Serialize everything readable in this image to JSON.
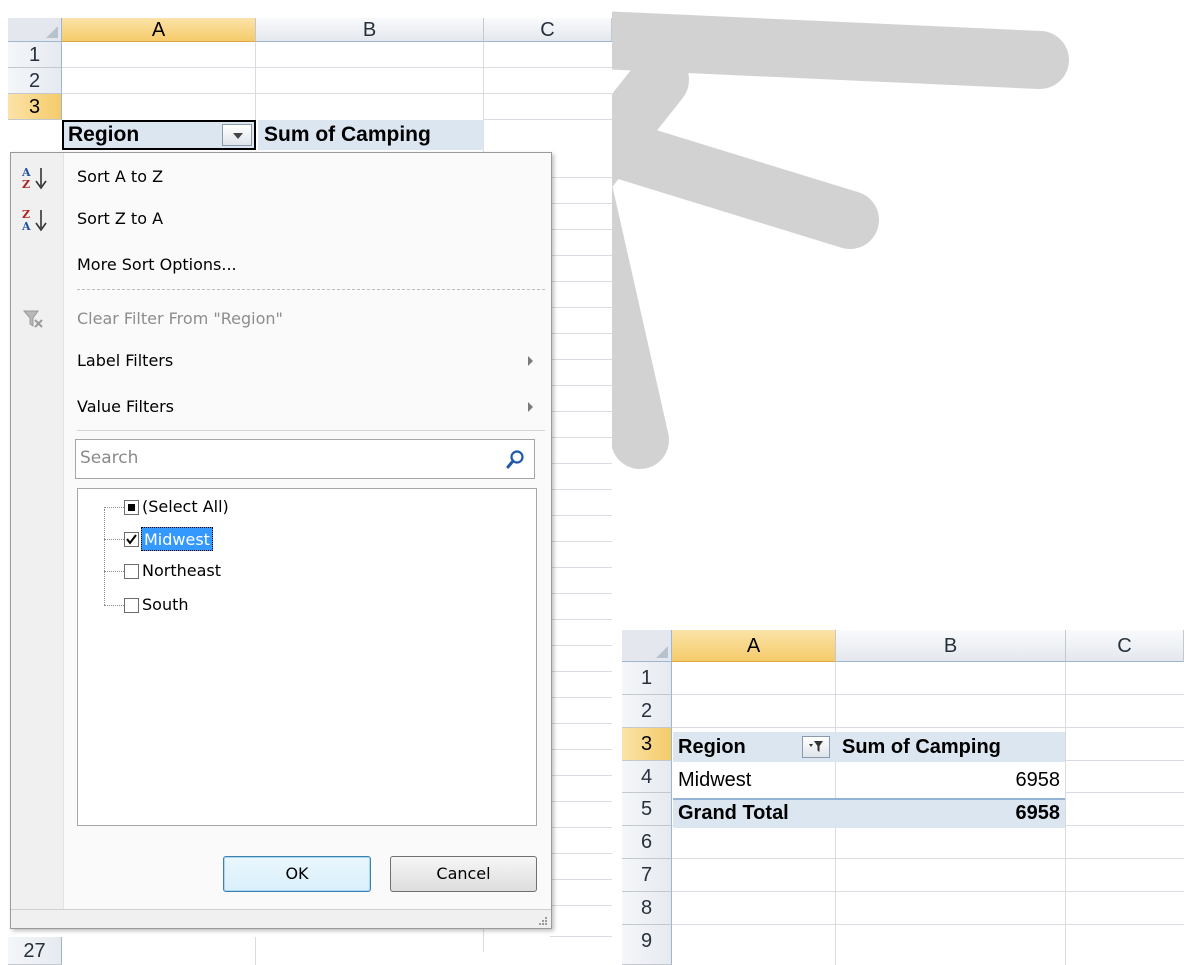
{
  "left_sheet": {
    "columns": [
      "A",
      "B",
      "C"
    ],
    "rows": [
      "1",
      "2",
      "3"
    ],
    "bottom_row": "27",
    "cells": {
      "a3": "Region",
      "b3": "Sum of Camping"
    }
  },
  "filter_menu": {
    "sort_az": "Sort A to Z",
    "sort_za": "Sort Z to A",
    "more_sort": "More Sort Options...",
    "clear_filter": "Clear Filter From \"Region\"",
    "label_filters": "Label Filters",
    "value_filters": "Value Filters",
    "search_placeholder": "Search",
    "items": [
      {
        "label": "(Select All)",
        "state": "partial"
      },
      {
        "label": "Midwest",
        "state": "checked"
      },
      {
        "label": "Northeast",
        "state": "unchecked"
      },
      {
        "label": "South",
        "state": "unchecked"
      }
    ],
    "ok": "OK",
    "cancel": "Cancel"
  },
  "right_sheet": {
    "columns": [
      "A",
      "B",
      "C"
    ],
    "rows": [
      "1",
      "2",
      "3",
      "4",
      "5",
      "6",
      "7",
      "8",
      "9"
    ],
    "header": {
      "a": "Region",
      "b": "Sum of Camping"
    },
    "data_row": {
      "a": "Midwest",
      "b": "6958"
    },
    "total_row": {
      "a": "Grand Total",
      "b": "6958"
    }
  },
  "colors": {
    "selected_header": "#f5cb6a",
    "pivot_header": "#dce6f1",
    "highlight": "#3399ff"
  }
}
